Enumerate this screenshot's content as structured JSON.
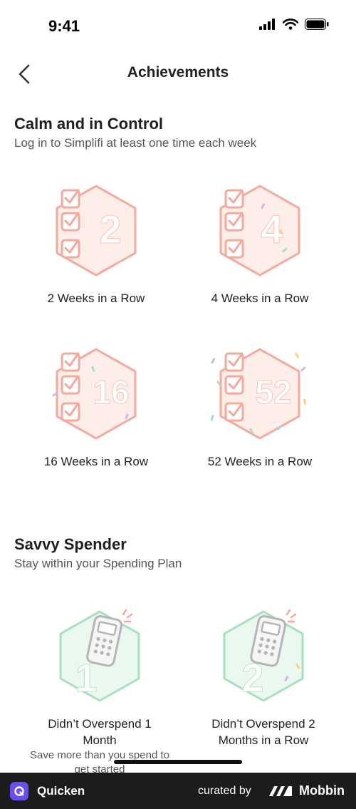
{
  "status_bar": {
    "time": "9:41"
  },
  "nav": {
    "title": "Achievements"
  },
  "sections": [
    {
      "title": "Calm and in Control",
      "subtitle": "Log in to Simplifi at least one time each week",
      "badges": [
        {
          "number": "2",
          "label": "2 Weeks in a Row"
        },
        {
          "number": "4",
          "label": "4 Weeks in a Row"
        },
        {
          "number": "16",
          "label": "16 Weeks in a Row"
        },
        {
          "number": "52",
          "label": "52 Weeks in a Row"
        }
      ]
    },
    {
      "title": "Savvy Spender",
      "subtitle": "Stay within your Spending Plan",
      "badges": [
        {
          "number": "1",
          "label": "Didn’t Overspend 1 Month",
          "description": "Save more than you spend to get started"
        },
        {
          "number": "2",
          "label": "Didn’t Overspend 2 Months in a Row"
        }
      ]
    }
  ],
  "footer": {
    "brand": "Quicken",
    "curated_by": "curated by",
    "mobbin": "Mobbin"
  },
  "colors": {
    "red_badge_stroke": "#f4a99d",
    "red_badge_fill": "#fde4df",
    "green_badge_stroke": "#a8e0bd",
    "green_badge_fill": "#dcf4e5",
    "footer_bg": "#1c1c1c",
    "quicken_logo": "#6b4cf5"
  }
}
